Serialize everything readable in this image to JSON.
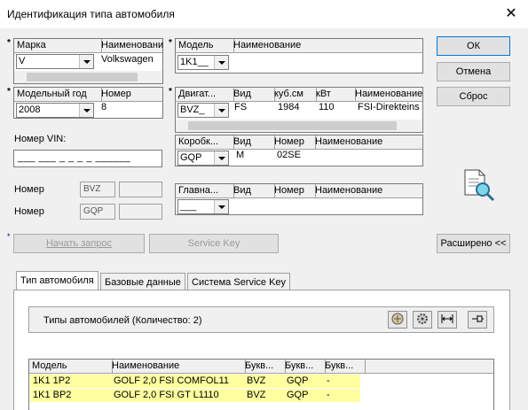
{
  "window": {
    "title": "Идентификация типа автомобиля",
    "close": "✕"
  },
  "marker": "*",
  "mark": {
    "headers": [
      "Марка",
      "Наименовани"
    ],
    "value": "V",
    "name": "Volkswagen"
  },
  "model": {
    "headers": [
      "Модель",
      "Наименование"
    ],
    "value": "1K1__"
  },
  "year": {
    "headers": [
      "Модельный год",
      "Номер"
    ],
    "value": "2008",
    "number": "8"
  },
  "engine": {
    "headers": [
      "Двигат...",
      "Вид",
      "куб.см",
      "кВт",
      "Наименование"
    ],
    "value": "BVZ_",
    "kind": "FS",
    "cc": "1984",
    "kw": "110",
    "name": "FSI-Direkteins"
  },
  "gearbox": {
    "headers": [
      "Коробк...",
      "Вид",
      "Номер",
      "Наименование"
    ],
    "value": "GQP",
    "kind": "M",
    "number": "02SE"
  },
  "main_gear": {
    "headers": [
      "Главна...",
      "Вид",
      "Номер",
      "Наименование"
    ],
    "value": "___"
  },
  "vin": {
    "label": "Номер VIN:",
    "mask": "___ ___ _ _ _ _ ______"
  },
  "numbers": [
    {
      "label": "Номер",
      "value": "BVZ"
    },
    {
      "label": "Номер",
      "value": "GQP"
    }
  ],
  "buttons": {
    "ok": "ОК",
    "cancel": "Отмена",
    "reset": "Сброс",
    "start": "Начать запрос",
    "service_key": "Service Key",
    "extended": "Расширено <<"
  },
  "tabs": [
    "Тип автомобиля",
    "Базовые данные",
    "Система Service Key"
  ],
  "types": {
    "title": "Типы автомобилей (Количество: 2)",
    "headers": [
      "Модель",
      "Наименование",
      "Букв...",
      "Букв...",
      "Букв..."
    ],
    "rows": [
      [
        "1K1 1P2",
        "GOLF 2,0 FSI COMFOL11",
        "BVZ",
        "GQP",
        "-"
      ],
      [
        "1K1 BP2",
        "GOLF 2,0 FSI GT L1110",
        "BVZ",
        "GQP",
        "-"
      ]
    ],
    "row_color": "#ffffa0"
  },
  "icons": [
    "document-search-icon",
    "filter-icon",
    "gear-icon",
    "width-icon",
    "pin-icon"
  ]
}
